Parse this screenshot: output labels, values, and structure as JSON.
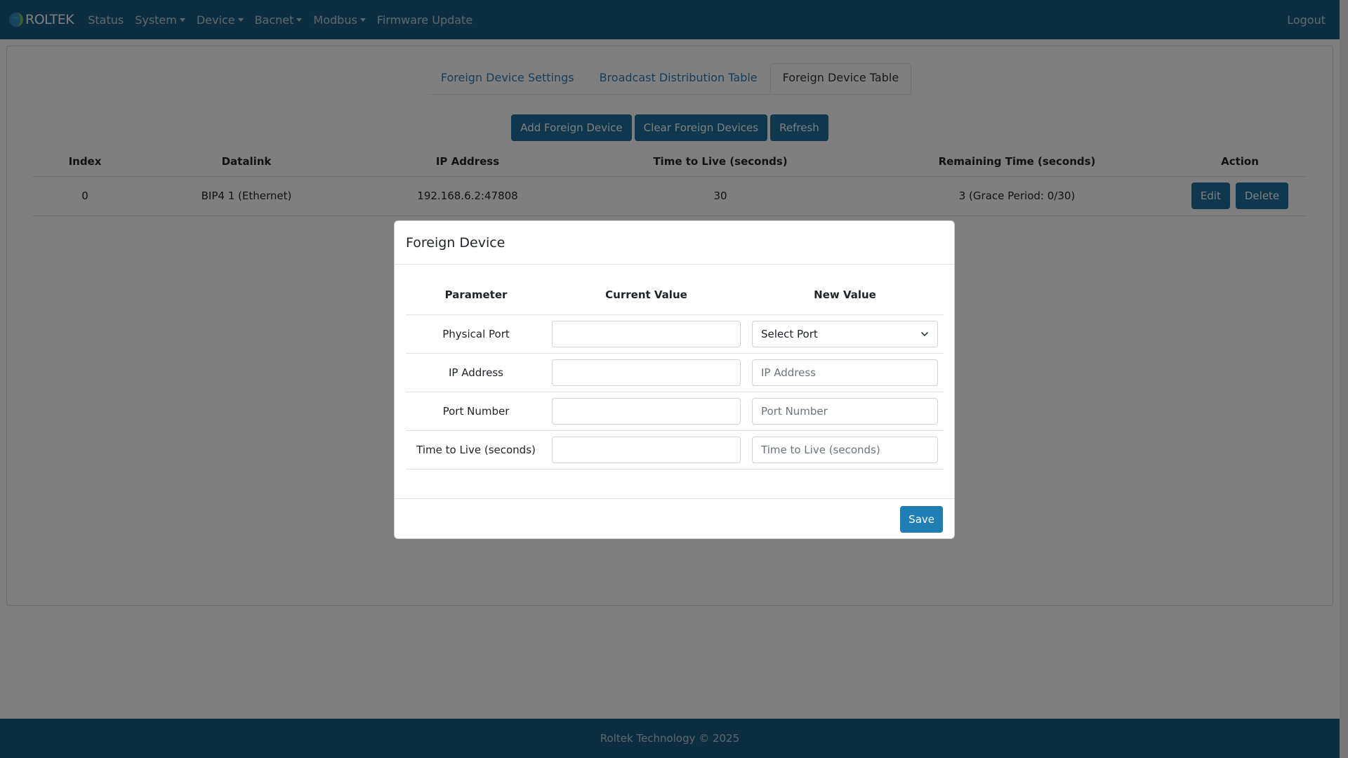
{
  "navbar": {
    "brand": "ROLTEK",
    "items": [
      {
        "label": "Status",
        "dropdown": false
      },
      {
        "label": "System",
        "dropdown": true
      },
      {
        "label": "Device",
        "dropdown": true
      },
      {
        "label": "Bacnet",
        "dropdown": true
      },
      {
        "label": "Modbus",
        "dropdown": true
      },
      {
        "label": "Firmware Update",
        "dropdown": false
      }
    ],
    "logout": "Logout",
    "bg_color": "#1a5d80"
  },
  "tabs": [
    {
      "label": "Foreign Device Settings",
      "active": false
    },
    {
      "label": "Broadcast Distribution Table",
      "active": false
    },
    {
      "label": "Foreign Device Table",
      "active": true
    }
  ],
  "buttons": {
    "add": "Add Foreign Device",
    "clear": "Clear Foreign Devices",
    "refresh": "Refresh"
  },
  "table": {
    "headers": [
      "Index",
      "Datalink",
      "IP Address",
      "Time to Live (seconds)",
      "Remaining Time (seconds)",
      "Action"
    ],
    "rows": [
      {
        "index": "0",
        "datalink": "BIP4 1 (Ethernet)",
        "ip": "192.168.6.2:47808",
        "ttl": "30",
        "remaining": "3 (Grace Period: 0/30)",
        "edit": "Edit",
        "delete": "Delete"
      }
    ]
  },
  "modal": {
    "title": "Foreign Device",
    "headers": {
      "parameter": "Parameter",
      "current": "Current Value",
      "new": "New Value"
    },
    "rows": {
      "physical_port": {
        "label": "Physical Port",
        "current": "",
        "select_value": "Select Port"
      },
      "ip_address": {
        "label": "IP Address",
        "current": "",
        "placeholder": "IP Address"
      },
      "port_number": {
        "label": "Port Number",
        "current": "",
        "placeholder": "Port Number"
      },
      "ttl": {
        "label": "Time to Live (seconds)",
        "current": "",
        "placeholder": "Time to Live (seconds)"
      }
    },
    "save": "Save"
  },
  "footer": {
    "text": "Roltek Technology © 2025"
  },
  "colors": {
    "primary_button": "#1f6f9a",
    "link": "#2a7ab8",
    "save_button": "#1f7fb4"
  }
}
